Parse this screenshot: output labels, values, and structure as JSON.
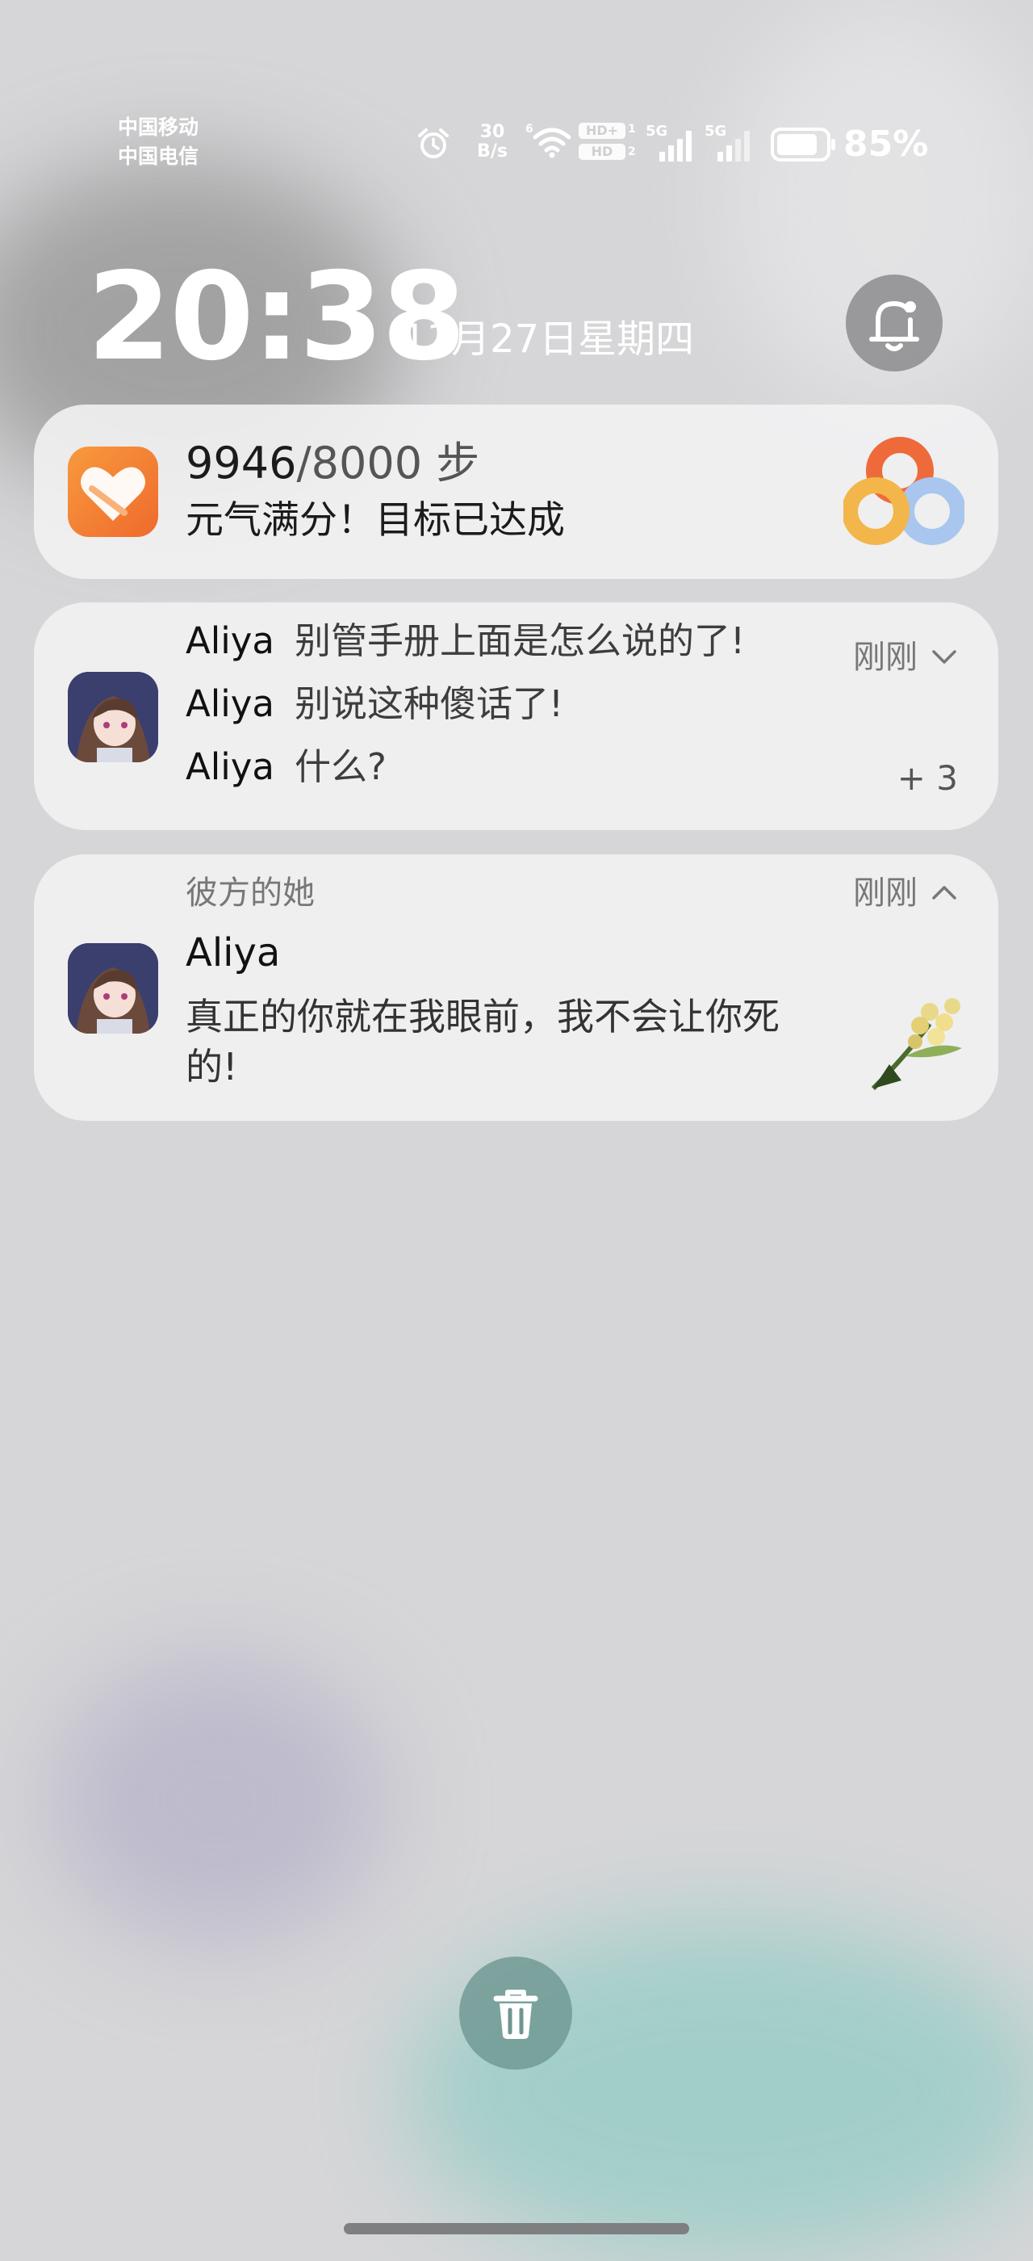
{
  "status_bar": {
    "carrier_1": "中国移动",
    "carrier_2": "中国电信",
    "net_speed_value": "30",
    "net_speed_unit": "B/s",
    "wifi_tag": "6",
    "hd1": "HD+",
    "hd1_sub": "1",
    "hd2": "HD",
    "hd2_sub": "2",
    "sim1_net": "5G",
    "sim2_net": "5G",
    "battery_percent": "85%",
    "battery_level": 0.85
  },
  "lockscreen": {
    "time": "20:38",
    "date": "11月27日星期四"
  },
  "notifications": {
    "health": {
      "steps_current": "9946",
      "steps_goal": "/8000 步",
      "message": "元气满分！目标已达成"
    },
    "chat_group": {
      "time": "刚刚",
      "more_count": "+ 3",
      "messages": [
        {
          "sender": "Aliya",
          "text": "别管手册上面是怎么说的了!"
        },
        {
          "sender": "Aliya",
          "text": "别说这种傻话了!"
        },
        {
          "sender": "Aliya",
          "text": "什么?"
        }
      ]
    },
    "chat_expanded": {
      "group": "彼方的她",
      "time": "刚刚",
      "sender": "Aliya",
      "text": "真正的你就在我眼前，我不会让你死的!"
    }
  },
  "colors": {
    "health_icon": "#f2833a",
    "ring_orange": "#ef6a3a",
    "ring_yellow": "#f3b64a",
    "ring_blue": "#a9c6ee",
    "trash_button": "#6e9691"
  }
}
